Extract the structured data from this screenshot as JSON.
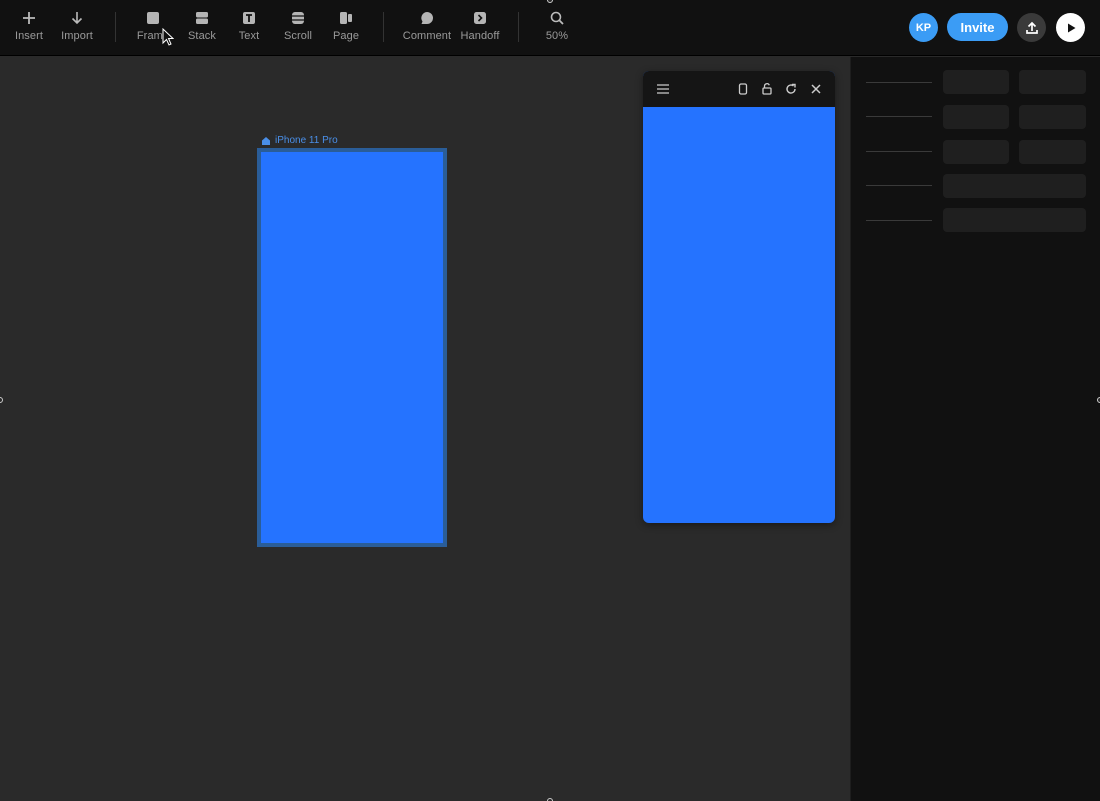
{
  "toolbar": {
    "tools": [
      {
        "label": "Insert",
        "icon": "plus-icon"
      },
      {
        "label": "Import",
        "icon": "arrow-down-icon"
      },
      {
        "label": "Frame",
        "icon": "frame-icon"
      },
      {
        "label": "Stack",
        "icon": "stack-icon"
      },
      {
        "label": "Text",
        "icon": "text-icon"
      },
      {
        "label": "Scroll",
        "icon": "scroll-icon"
      },
      {
        "label": "Page",
        "icon": "page-icon"
      },
      {
        "label": "Comment",
        "icon": "comment-icon"
      },
      {
        "label": "Handoff",
        "icon": "handoff-icon"
      },
      {
        "label": "50%",
        "icon": "search-icon"
      }
    ],
    "avatar_initials": "KP",
    "invite_label": "Invite"
  },
  "canvas": {
    "frame_label": "iPhone 11 Pro",
    "frame_color": "#2573ff"
  },
  "colors": {
    "accent": "#3b9cf5",
    "toolbar_bg": "#111111",
    "canvas_bg": "#2a2a2a"
  }
}
